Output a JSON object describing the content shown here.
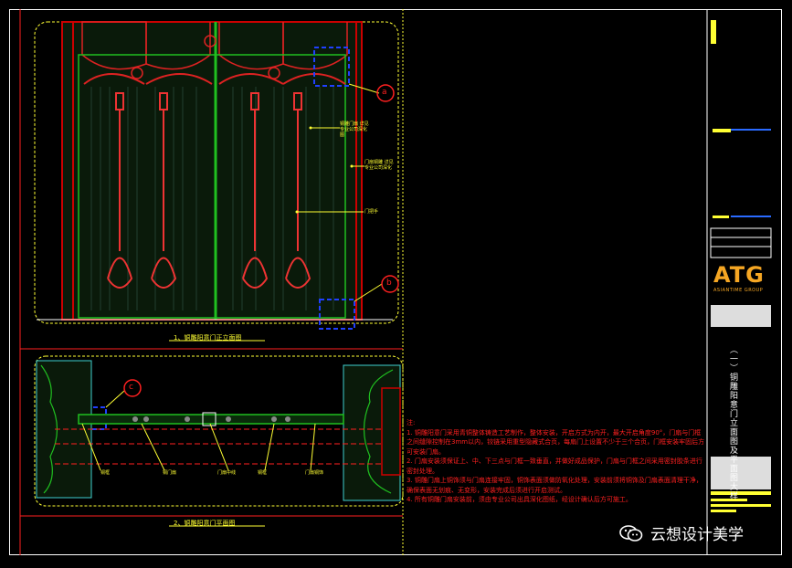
{
  "drawing": {
    "elevation_title": "1、铜雕阳意门正立面图",
    "plan_title": "2、铜雕阳意门平面图",
    "callouts": [
      "a",
      "b",
      "c"
    ],
    "elevation_labels": [
      "铜雕门扇 详见专业公司深化图",
      "门扇铜雕 详见专业公司深化",
      "门把手"
    ],
    "plan_labels": [
      "铜框",
      "铜门扇",
      "门扇中线",
      "铜框",
      "门扇铜饰"
    ]
  },
  "notes": {
    "header": "注:",
    "items": [
      "1. 铜雕阳意门采用青铜整体铸造工艺制作，整体安装，开启方式为内开，最大开启角度90°，门扇与门框之间缝隙控制在3mm以内，铰链采用重型隐藏式合页，每扇门上设置不少于三个合页，门框安装牢固后方可安装门扇。",
      "2. 门扇安装须保证上、中、下三点与门框一致垂直，并做好成品保护，门扇与门框之间采用密封胶条进行密封处理。",
      "3. 铜雕门扇上铜饰须与门扇连接牢固，铜饰表面须做防氧化处理，安装前须将铜饰及门扇表面清理干净，确保表面无划痕、无变形，安装完成后须进行开启测试。",
      "4. 所有铜雕门扇安装前，须由专业公司出具深化图纸，经设计确认后方可施工。"
    ]
  },
  "title_block": {
    "logo": "ATG",
    "logo_sub": "ASIANTIME GROUP",
    "sheet_title": "（一）铜雕阳意门立面图及平面图大样"
  },
  "watermark": "云想设计美学",
  "colors": {
    "background": "#000000",
    "frame": "#ffffff",
    "yellow": "#ffff33",
    "red": "#ff2020",
    "green": "#20c020",
    "blue": "#2040ff",
    "cyan": "#3fd0d0"
  }
}
